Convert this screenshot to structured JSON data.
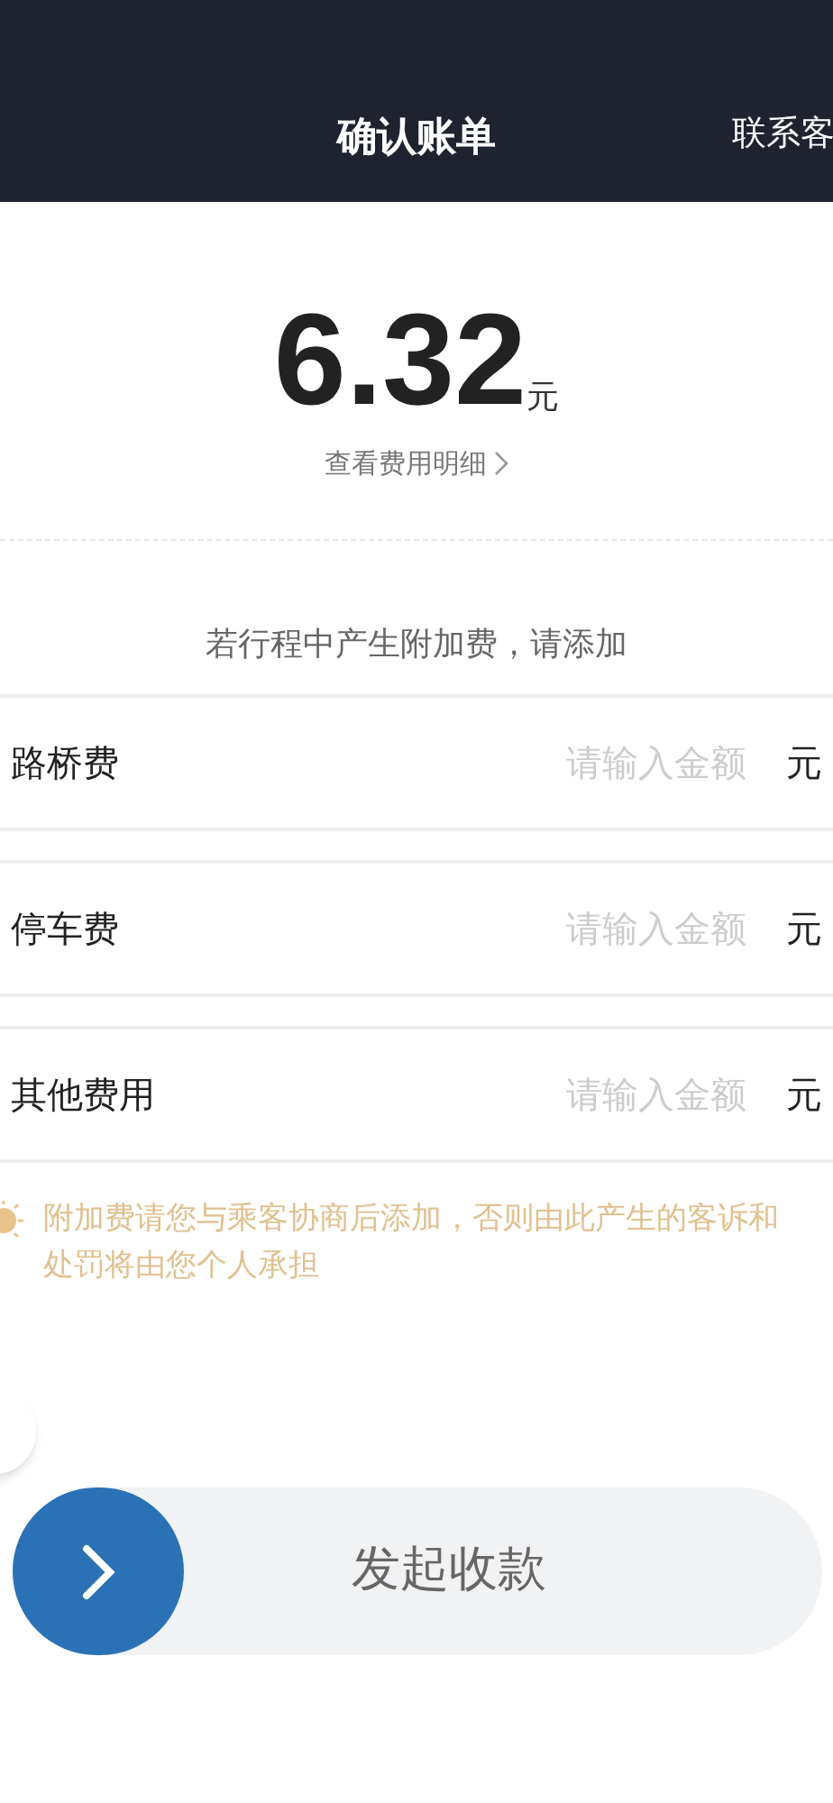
{
  "header": {
    "title": "确认账单",
    "action": "联系客"
  },
  "bill": {
    "amount": "6.32",
    "unit": "元",
    "detail_link": "查看费用明细"
  },
  "extra_fees": {
    "hint": "若行程中产生附加费，请添加",
    "items": [
      {
        "label": "路桥费",
        "placeholder": "请输入金额",
        "unit": "元"
      },
      {
        "label": "停车费",
        "placeholder": "请输入金额",
        "unit": "元"
      },
      {
        "label": "其他费用",
        "placeholder": "请输入金额",
        "unit": "元"
      }
    ]
  },
  "notice": "附加费请您与乘客协商后添加，否则由此产生的客诉和处罚将由您个人承担",
  "slide_button": {
    "label": "发起收款"
  }
}
